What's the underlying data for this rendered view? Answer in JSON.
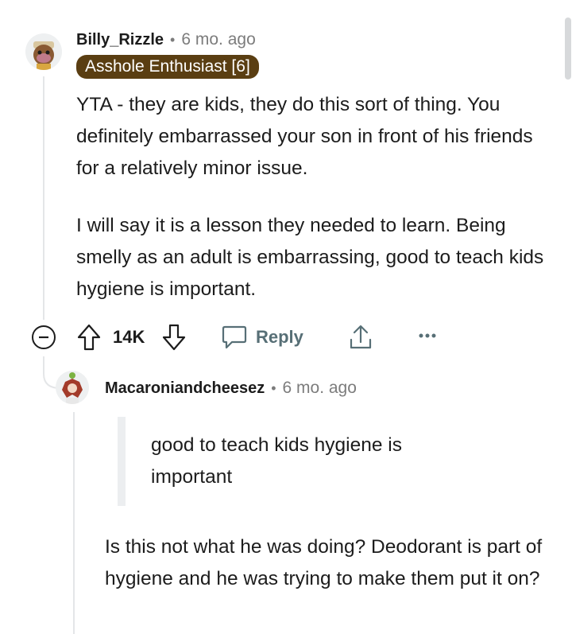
{
  "comment": {
    "author": "Billy_Rizzle",
    "separator": "•",
    "time": "6 mo. ago",
    "flair": "Asshole Enthusiast [6]",
    "paragraphs": [
      "YTA - they are kids, they do this sort of thing. You definitely embarrassed your son in front of his friends for a relatively minor issue.",
      "I will say it is a lesson they needed to learn. Being smelly as an adult is embarrassing, good to teach kids hygiene is important."
    ],
    "actions": {
      "score": "14K",
      "reply_label": "Reply"
    }
  },
  "reply": {
    "author": "Macaroniandcheesez",
    "separator": "•",
    "time": "6 mo. ago",
    "quote": "good to teach kids hygiene is important",
    "paragraph": "Is this not what he was doing? Deodorant is part of hygiene and he was trying to make them put it on?"
  },
  "colors": {
    "flair_bg": "#5a3e12",
    "meta_gray": "#7c7c7c",
    "action_gray": "#576f76"
  },
  "icons": [
    "collapse-icon",
    "upvote-icon",
    "downvote-icon",
    "reply-icon",
    "share-icon",
    "more-icon"
  ]
}
